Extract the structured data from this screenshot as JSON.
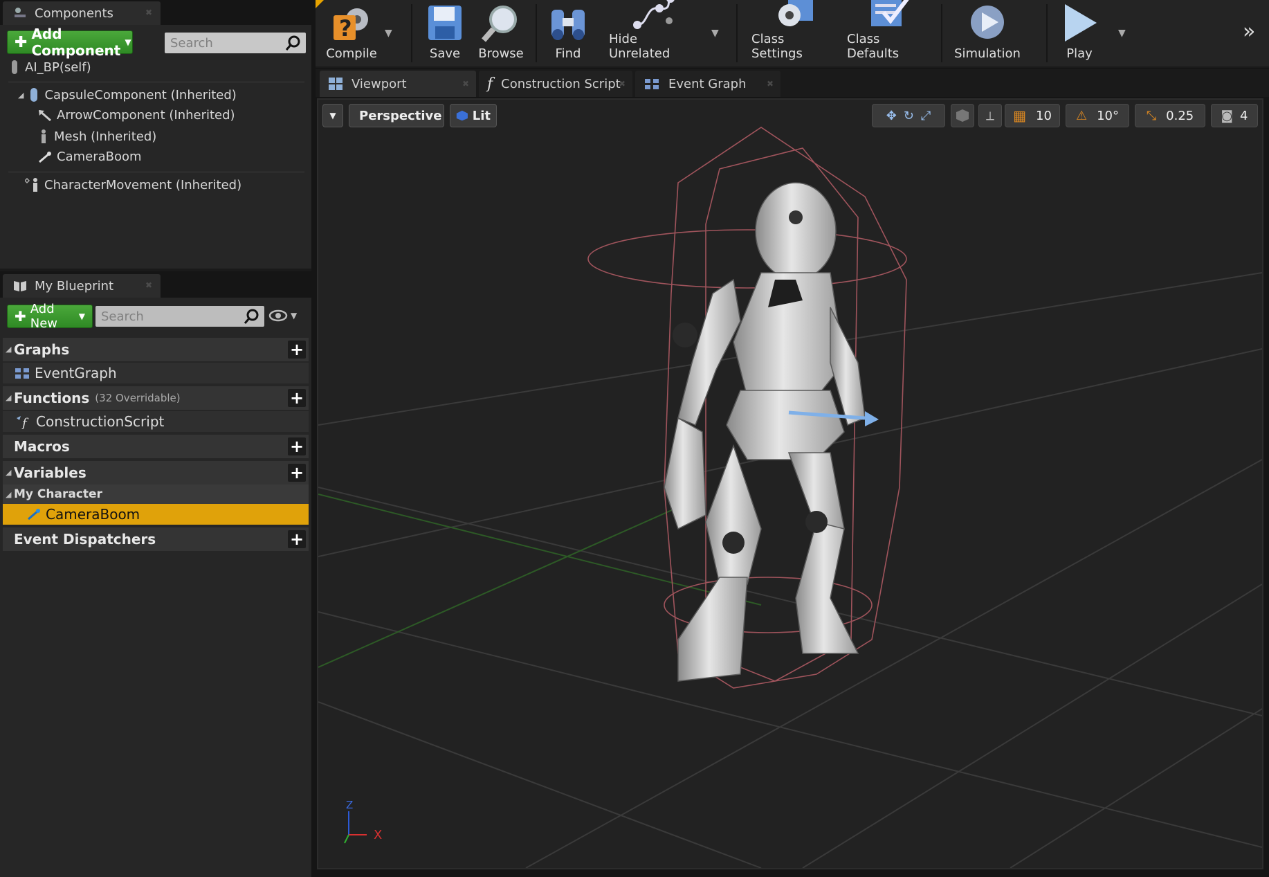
{
  "components": {
    "tab_label": "Components",
    "add_button": "Add Component",
    "search_placeholder": "Search",
    "self_label": "AI_BP(self)",
    "tree": [
      {
        "label": "CapsuleComponent (Inherited)"
      },
      {
        "label": "ArrowComponent (Inherited)"
      },
      {
        "label": "Mesh (Inherited)"
      },
      {
        "label": "CameraBoom"
      },
      {
        "label": "CharacterMovement (Inherited)"
      }
    ]
  },
  "my_blueprint": {
    "tab_label": "My Blueprint",
    "add_button": "Add New",
    "search_placeholder": "Search",
    "sections": {
      "graphs": "Graphs",
      "event_graph": "EventGraph",
      "functions": "Functions",
      "functions_note": "(32 Overridable)",
      "construction_script": "ConstructionScript",
      "macros": "Macros",
      "variables": "Variables",
      "my_character": "My Character",
      "camera_boom": "CameraBoom",
      "event_dispatchers": "Event Dispatchers"
    }
  },
  "toolbar": {
    "compile": "Compile",
    "save": "Save",
    "browse": "Browse",
    "find": "Find",
    "hide_unrelated": "Hide Unrelated",
    "class_settings": "Class Settings",
    "class_defaults": "Class Defaults",
    "simulation": "Simulation",
    "play": "Play"
  },
  "editor_tabs": [
    {
      "label": "Viewport"
    },
    {
      "label": "Construction Script"
    },
    {
      "label": "Event Graph"
    }
  ],
  "viewport": {
    "perspective": "Perspective",
    "lit": "Lit",
    "grid_snap": "10",
    "rotation_snap": "10°",
    "scale_snap": "0.25",
    "camera_speed": "4",
    "axis_x": "X",
    "axis_z": "Z"
  },
  "colors": {
    "accent_green": "#3a9a2e",
    "selection_orange": "#e0a20a",
    "snap_orange": "#d9861a"
  }
}
